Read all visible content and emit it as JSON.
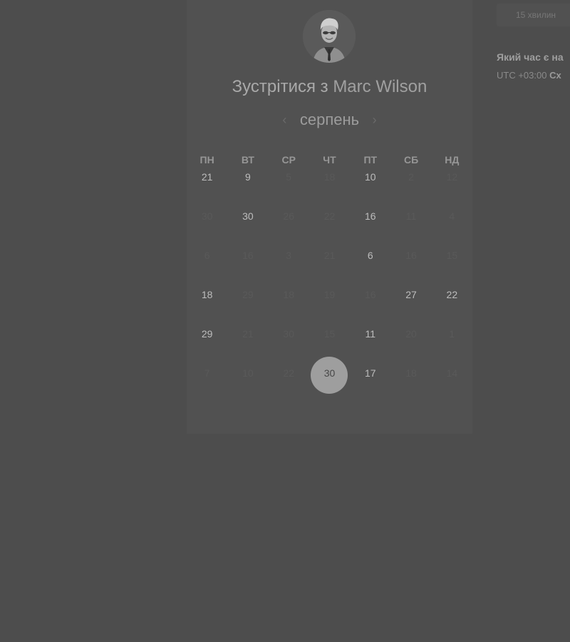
{
  "host": {
    "title_prefix": "Зустрітися з",
    "name": "Marc Wilson"
  },
  "calendar": {
    "month": "серпень",
    "prev_icon": "chevron-left-icon",
    "next_icon": "chevron-right-icon",
    "weekdays": [
      "ПН",
      "ВТ",
      "СР",
      "ЧТ",
      "ПТ",
      "СБ",
      "НД"
    ],
    "weeks": [
      [
        {
          "d": "21",
          "s": "active"
        },
        {
          "d": "9",
          "s": "active"
        },
        {
          "d": "5",
          "s": "dim"
        },
        {
          "d": "18",
          "s": "dim"
        },
        {
          "d": "10",
          "s": "active"
        },
        {
          "d": "2",
          "s": "dim"
        },
        {
          "d": "12",
          "s": "dim"
        }
      ],
      [
        {
          "d": "30",
          "s": "dim"
        },
        {
          "d": "30",
          "s": "active"
        },
        {
          "d": "26",
          "s": "dim"
        },
        {
          "d": "22",
          "s": "dim"
        },
        {
          "d": "16",
          "s": "active"
        },
        {
          "d": "11",
          "s": "dim"
        },
        {
          "d": "4",
          "s": "dim"
        }
      ],
      [
        {
          "d": "6",
          "s": "dim"
        },
        {
          "d": "16",
          "s": "dim"
        },
        {
          "d": "3",
          "s": "dim"
        },
        {
          "d": "21",
          "s": "dim"
        },
        {
          "d": "6",
          "s": "active"
        },
        {
          "d": "16",
          "s": "dim"
        },
        {
          "d": "15",
          "s": "dim"
        }
      ],
      [
        {
          "d": "18",
          "s": "active"
        },
        {
          "d": "29",
          "s": "dim"
        },
        {
          "d": "18",
          "s": "dim"
        },
        {
          "d": "19",
          "s": "dim"
        },
        {
          "d": "16",
          "s": "dim"
        },
        {
          "d": "27",
          "s": "active"
        },
        {
          "d": "22",
          "s": "active"
        }
      ],
      [
        {
          "d": "29",
          "s": "active"
        },
        {
          "d": "21",
          "s": "dim"
        },
        {
          "d": "30",
          "s": "dim"
        },
        {
          "d": "15",
          "s": "dim"
        },
        {
          "d": "11",
          "s": "active"
        },
        {
          "d": "20",
          "s": "dim"
        },
        {
          "d": "1",
          "s": "dim"
        }
      ],
      [
        {
          "d": "7",
          "s": "dim"
        },
        {
          "d": "10",
          "s": "dim"
        },
        {
          "d": "22",
          "s": "dim"
        },
        {
          "d": "30",
          "s": "selected"
        },
        {
          "d": "17",
          "s": "active"
        },
        {
          "d": "18",
          "s": "dim"
        },
        {
          "d": "14",
          "s": "dim"
        }
      ]
    ]
  },
  "sidebar": {
    "duration": "15 хвилин",
    "timezone_question": "Який час є на",
    "timezone_offset": "UTC +03:00",
    "timezone_name": "Сх"
  }
}
